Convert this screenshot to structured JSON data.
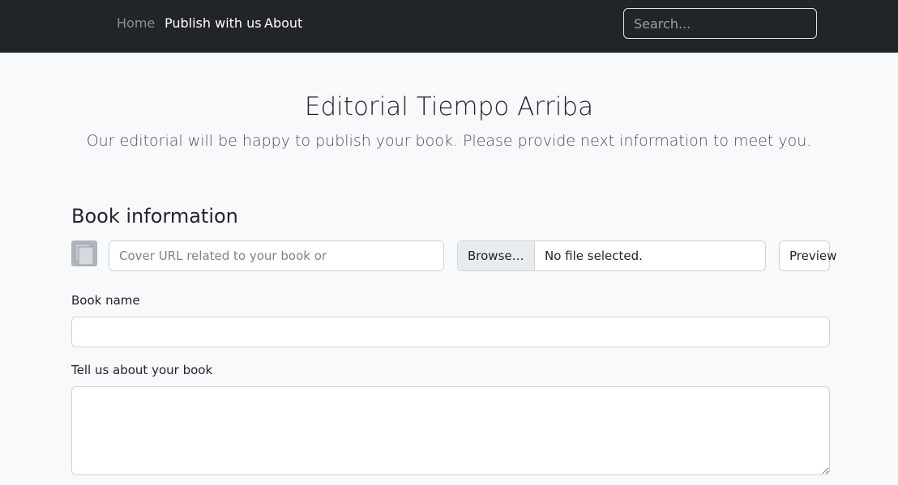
{
  "nav": {
    "items": [
      {
        "label": "Home"
      },
      {
        "label": "Publish with us"
      },
      {
        "label": "About"
      }
    ],
    "search_placeholder": "Search..."
  },
  "hero": {
    "title": "Editorial Tiempo Arriba",
    "lead": "Our editorial will be happy to publish your book. Please provide next information to meet you."
  },
  "book_info": {
    "title": "Book information",
    "cover_icon": "file-icon",
    "cover_url_placeholder": "Cover URL related to your book or",
    "browse_label": "Browse…",
    "file_status": "No file selected.",
    "preview_label": "Preview",
    "book_name_label": "Book name",
    "about_label": "Tell us about your book"
  },
  "colors": {
    "navbar_bg": "#212529",
    "page_bg": "#f8f9fa",
    "nav_active": "#ffffff",
    "nav_muted": "#8c9196"
  }
}
